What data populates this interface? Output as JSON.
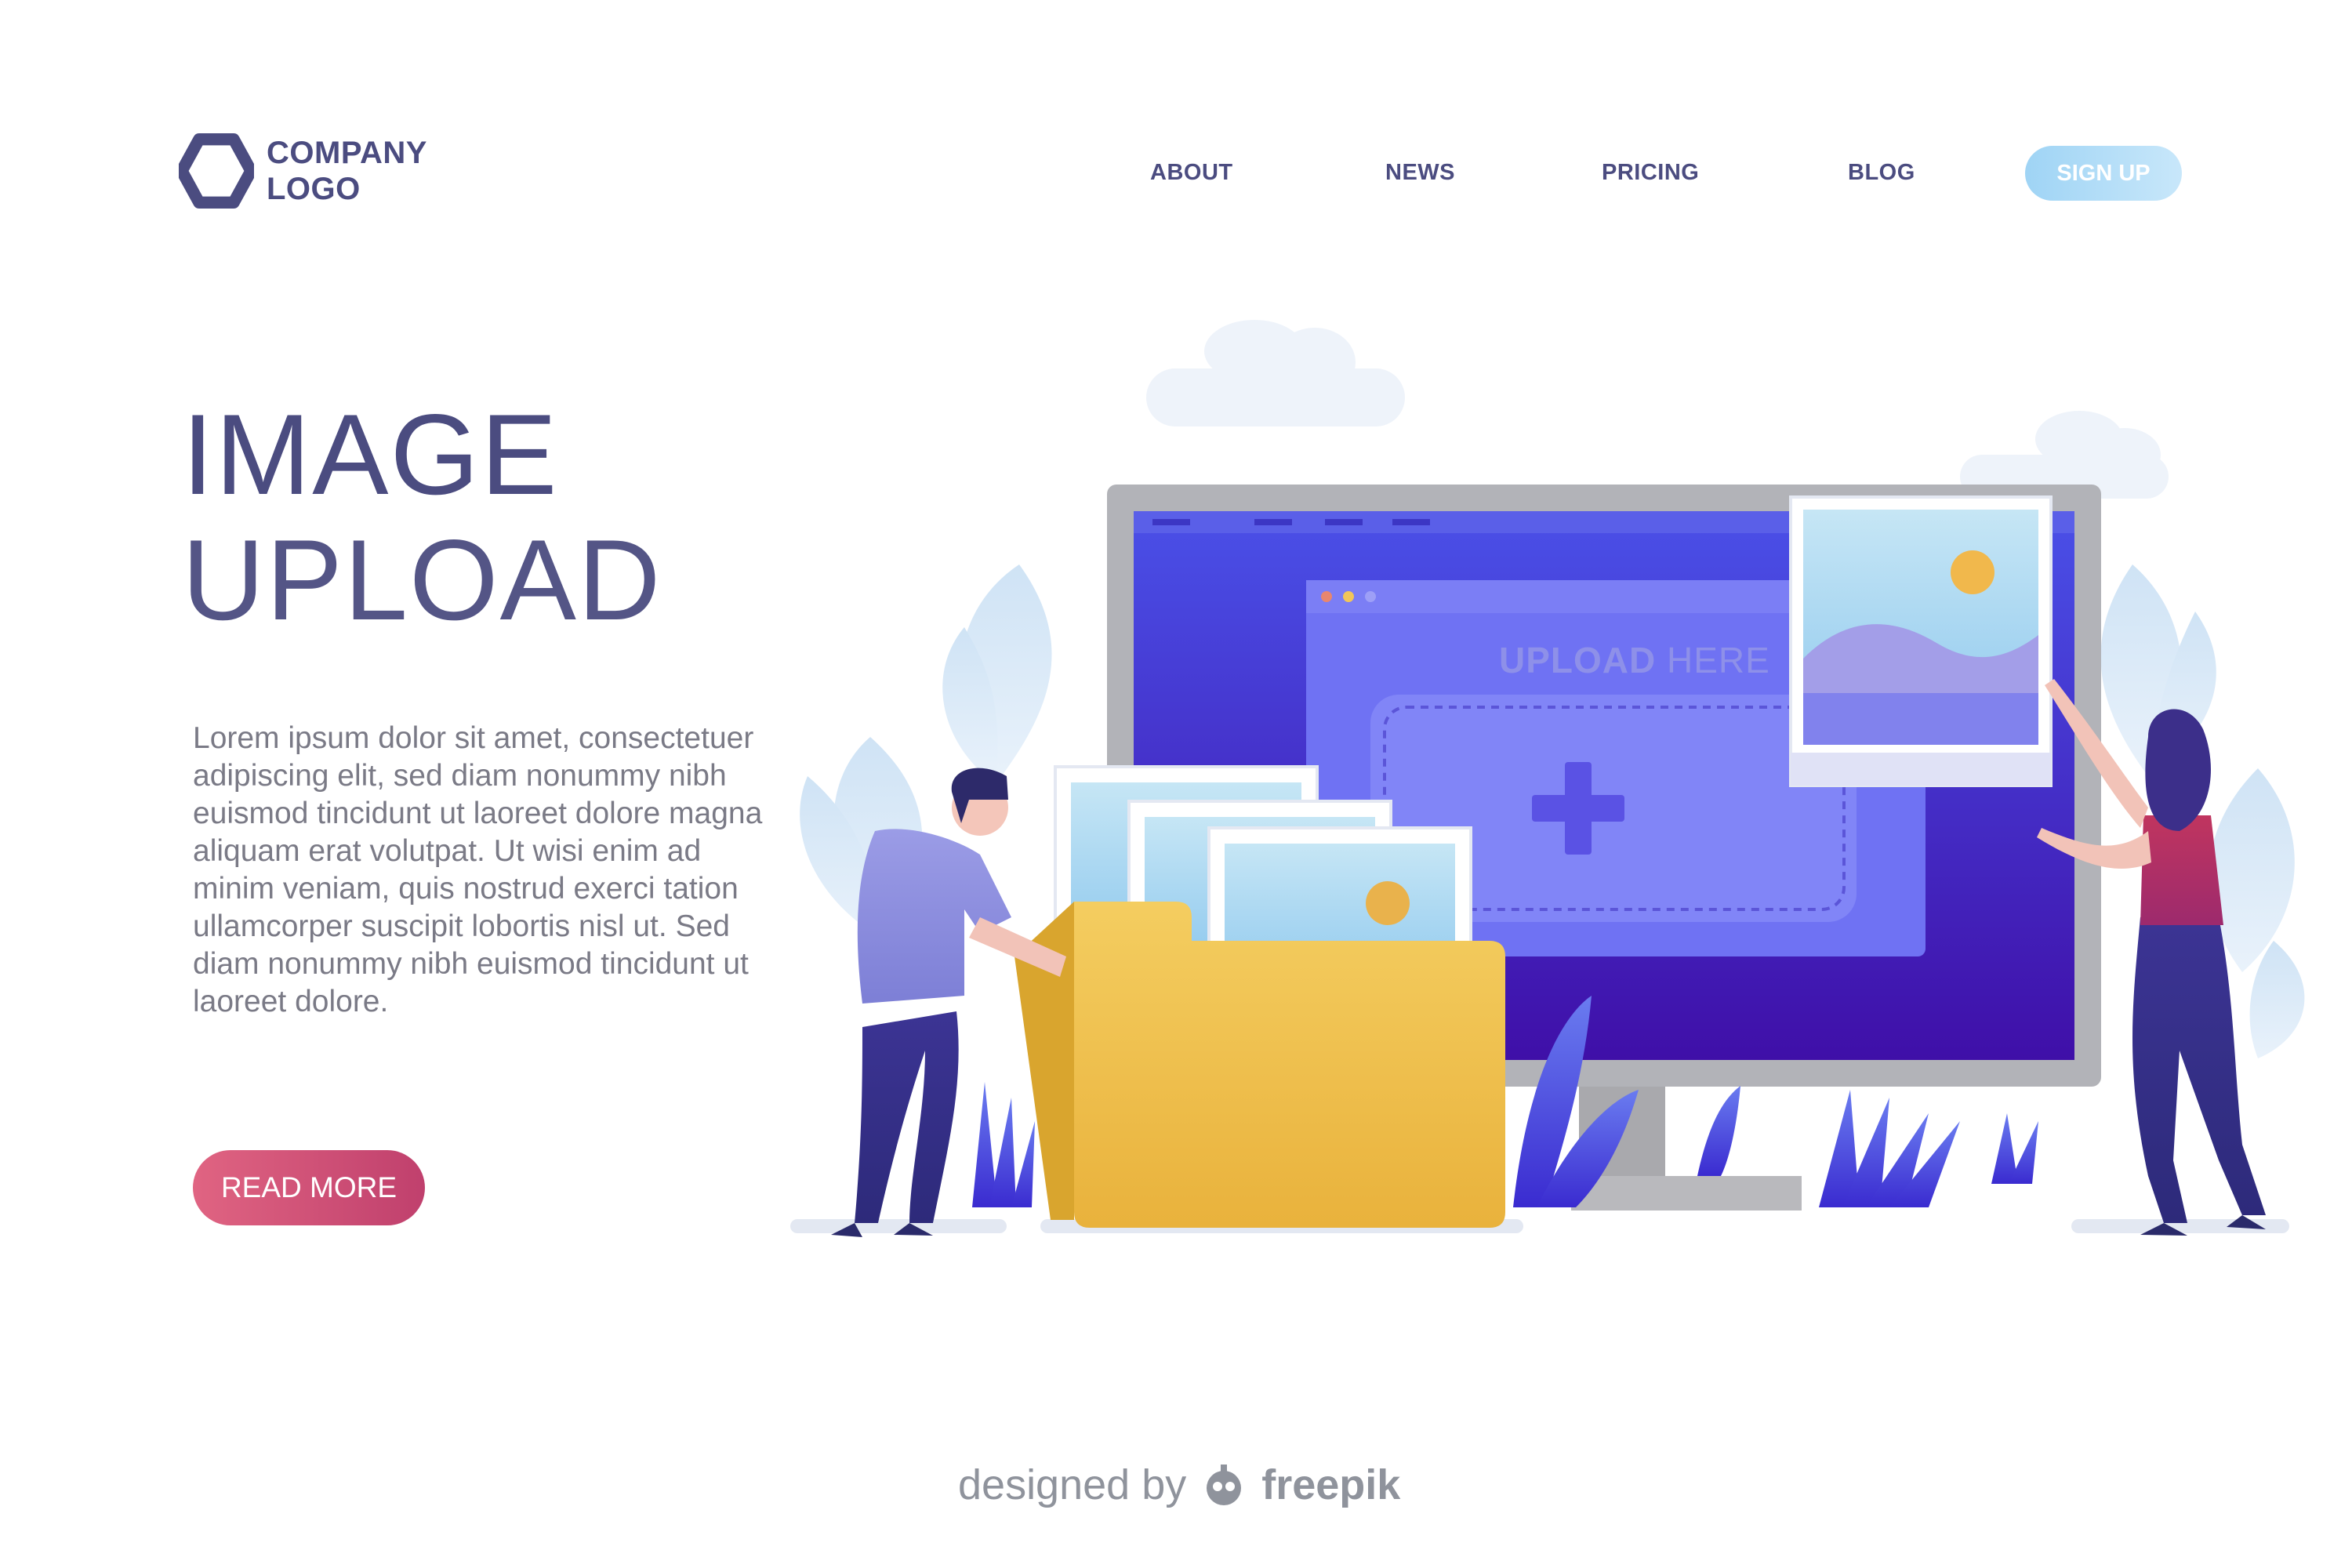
{
  "header": {
    "logo_line1": "COMPANY",
    "logo_line2": "LOGO",
    "nav": [
      "ABOUT",
      "NEWS",
      "PRICING",
      "BLOG"
    ],
    "signup_label": "SIGN UP"
  },
  "hero": {
    "title_line1": "IMAGE",
    "title_line2": "UPLOAD",
    "body": "Lorem ipsum dolor sit amet, consectetuer adipiscing elit, sed diam nonummy nibh euismod tincidunt ut laoreet dolore magna aliquam erat volutpat. Ut wisi enim ad minim veniam, quis nostrud exerci tation ullamcorper suscipit lobortis nisl ut. Sed diam nonummy nibh euismod tincidunt ut laoreet dolore.",
    "cta_label": "READ MORE"
  },
  "illustration": {
    "upload_bold": "UPLOAD",
    "upload_light": "HERE"
  },
  "footer": {
    "designed_by": "designed by",
    "brand": "freepik"
  },
  "colors": {
    "primary_text": "#4b4c80",
    "cta": "#d4526f",
    "signup": "#b4ddf7",
    "screen": "#4a3fe0",
    "folder": "#f0c24e"
  }
}
